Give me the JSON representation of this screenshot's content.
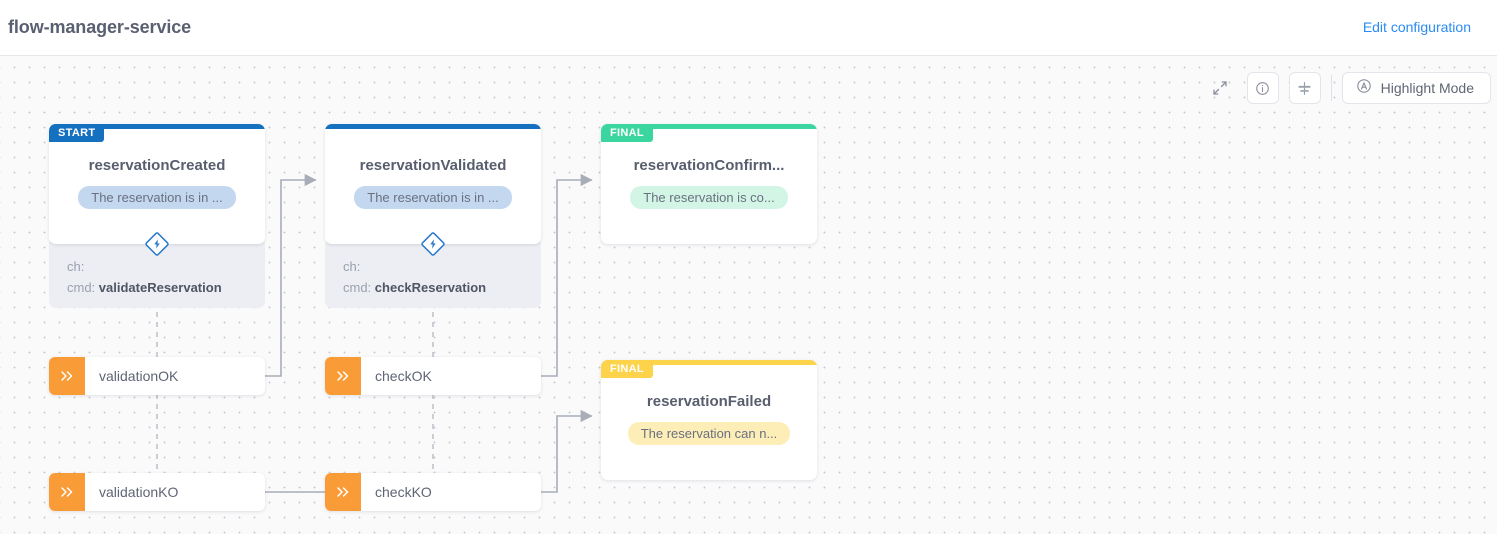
{
  "header": {
    "title": "flow-manager-service",
    "edit_link": "Edit configuration"
  },
  "toolbar": {
    "expand_icon": "expand-arrows-icon",
    "info_icon": "info-circle-icon",
    "distribute_icon": "distribute-vertical-icon",
    "highlight_icon": "circled-a-icon",
    "highlight_label": "Highlight Mode"
  },
  "diagram": {
    "colors": {
      "start": "#1570c0",
      "final_success": "#3bd6a0",
      "final_warning": "#fcd34b",
      "event": "#f99c38",
      "edge": "#a8adb8",
      "link": "#2a8cf5"
    },
    "states": [
      {
        "id": "reservationCreated",
        "badge": "START",
        "name": "reservationCreated",
        "description": "The reservation is in ...",
        "desc_bg": "#c3d8ef",
        "bar_color": "#1570c0",
        "badge_color": "#1570c0",
        "command": {
          "channel_label": "ch:",
          "channel_value": "",
          "cmd_label": "cmd:",
          "cmd_value": "validateReservation"
        }
      },
      {
        "id": "reservationValidated",
        "badge": "",
        "name": "reservationValidated",
        "description": "The reservation is in ...",
        "desc_bg": "#c3d8ef",
        "bar_color": "#1570c0",
        "badge_color": "#1570c0",
        "command": {
          "channel_label": "ch:",
          "channel_value": "",
          "cmd_label": "cmd:",
          "cmd_value": "checkReservation"
        }
      },
      {
        "id": "reservationConfirmed",
        "badge": "FINAL",
        "name": "reservationConfirm...",
        "description": "The reservation is co...",
        "desc_bg": "#d3f5e6",
        "bar_color": "#3bd6a0",
        "badge_color": "#3bd6a0",
        "command": null
      },
      {
        "id": "reservationFailed",
        "badge": "FINAL",
        "name": "reservationFailed",
        "description": "The reservation can n...",
        "desc_bg": "#fdeeb8",
        "bar_color": "#fcd34b",
        "badge_color": "#fcd34b",
        "command": null
      }
    ],
    "events": [
      {
        "id": "validationOK",
        "label": "validationOK",
        "icon": "double-chevron-right-icon"
      },
      {
        "id": "checkOK",
        "label": "checkOK",
        "icon": "double-chevron-right-icon"
      },
      {
        "id": "validationKO",
        "label": "validationKO",
        "icon": "double-chevron-right-icon"
      },
      {
        "id": "checkKO",
        "label": "checkKO",
        "icon": "double-chevron-right-icon"
      }
    ]
  }
}
